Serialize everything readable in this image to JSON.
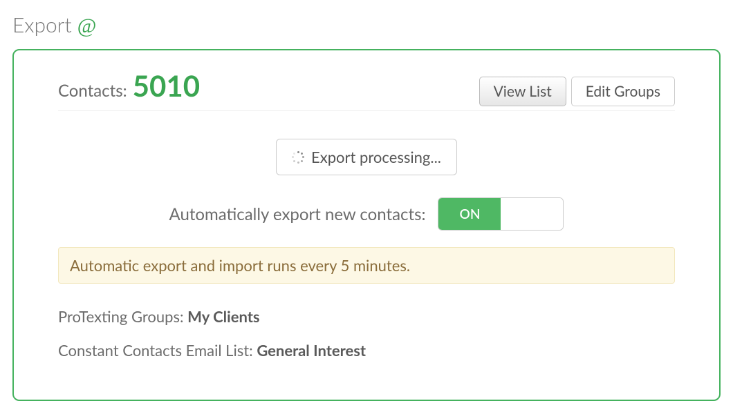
{
  "heading": {
    "text": "Export",
    "icon_char": "@"
  },
  "contacts": {
    "label": "Contacts:",
    "count": "5010"
  },
  "actions": {
    "view_list": "View List",
    "edit_groups": "Edit Groups"
  },
  "export_status": {
    "text": "Export processing..."
  },
  "auto_export": {
    "label": "Automatically export new contacts:",
    "on_label": "ON",
    "state": "on"
  },
  "alert": {
    "text": "Automatic export and import runs every 5 minutes."
  },
  "details": {
    "protexting_groups": {
      "label": "ProTexting Groups:",
      "value": "My Clients"
    },
    "constant_contacts": {
      "label": "Constant Contacts Email List:",
      "value": "General Interest"
    }
  }
}
